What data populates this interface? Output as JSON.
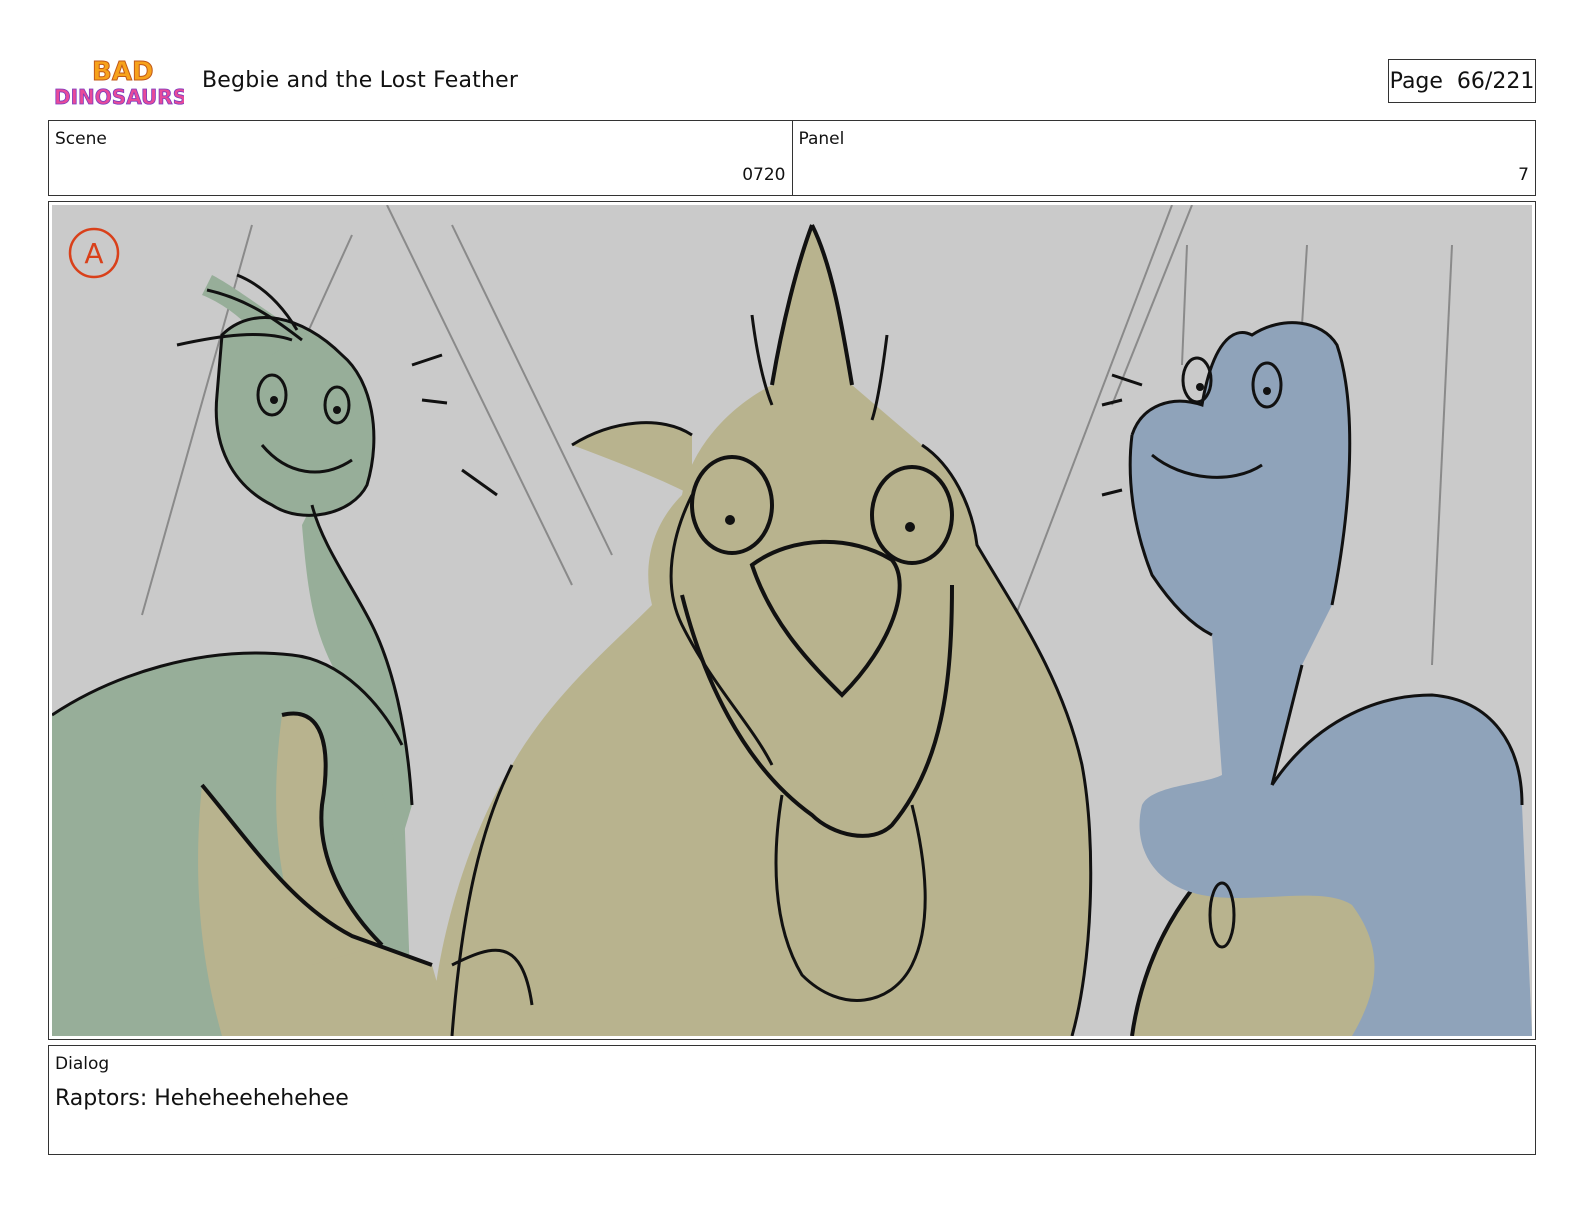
{
  "header": {
    "logo_text_top": "BAD",
    "logo_text_bottom": "DINOSAURS",
    "title": "Begbie and the Lost Feather",
    "page": "Page  66/221"
  },
  "info": {
    "scene_label": "Scene",
    "scene_value": "0720",
    "panel_label": "Panel",
    "panel_value": "7"
  },
  "frame": {
    "mark": "A",
    "colors": {
      "background": "#cacaca",
      "green_raptor": "#97ae99",
      "center_raptor": "#b8b38e",
      "blue_raptor": "#8fa3ba",
      "ink": "#111111",
      "mark": "#d9401a"
    }
  },
  "dialog": {
    "label": "Dialog",
    "text": "Raptors: Heheheehehehee"
  }
}
